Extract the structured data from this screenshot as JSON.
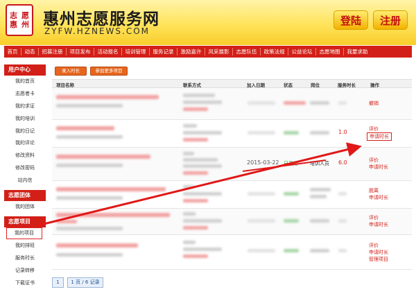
{
  "header": {
    "logo_chars": [
      "志",
      "愿",
      "惠",
      "州"
    ],
    "site_title": "惠州志愿服务网",
    "site_url": "ZYFW.HZNEWS.COM",
    "login_label": "登陆",
    "register_label": "注册"
  },
  "nav": [
    "首页",
    "动态",
    "招募注册",
    "项目发布",
    "活动报名",
    "培训管理",
    "服务记录",
    "激励嘉许",
    "风采展影",
    "志愿队伍",
    "政策法规",
    "公益论坛",
    "志愿地图",
    "我要求助"
  ],
  "sidebar": {
    "user_center": {
      "title": "用户中心",
      "items": [
        "我的首页",
        "志愿者卡",
        "我的求证",
        "我的培训",
        "我的日记",
        "我的评论",
        "修改资料",
        "修改密码",
        "站内信"
      ]
    },
    "groups": {
      "title": "志愿团体",
      "items": [
        "我的团体"
      ]
    },
    "projects": {
      "title": "志愿项目",
      "items": [
        "我的项目",
        "我的排班",
        "服务时长",
        "记录转移",
        "下载证书"
      ]
    }
  },
  "toolbar": {
    "record_hours_label": "录入时长",
    "join_more_label": "参加更多项目"
  },
  "table": {
    "headers": [
      "项目名称",
      "联系方式",
      "加入日期",
      "状态",
      "岗位",
      "服务时长",
      "操作"
    ],
    "rows": [
      {
        "date": "",
        "status": "",
        "role": "",
        "hours": "",
        "ops": [
          "撤销"
        ]
      },
      {
        "date": "",
        "status": "",
        "role": "",
        "hours": "1.0",
        "ops": [
          "评价",
          "申请时长"
        ]
      },
      {
        "date": "2015-03-22",
        "status": "已录用",
        "role": "培训人员",
        "hours": "6.0",
        "ops": [
          "评价",
          "申请时长"
        ]
      },
      {
        "date": "",
        "status": "",
        "role": "",
        "hours": "",
        "ops": [
          "脱离",
          "申请时长"
        ]
      },
      {
        "date": "",
        "status": "",
        "role": "",
        "hours": "",
        "ops": [
          "评价",
          "申请时长"
        ]
      },
      {
        "date": "",
        "status": "",
        "role": "",
        "hours": "",
        "ops": [
          "评价",
          "申请时长",
          "管理项目"
        ]
      }
    ]
  },
  "pagination": {
    "current": "1",
    "summary": "1 页 / 6 记录"
  },
  "colors": {
    "brand_red": "#d21f17",
    "header_yellow": "#ffe35a",
    "status_green": "#1e9d2a",
    "button_orange": "#e6661e"
  }
}
